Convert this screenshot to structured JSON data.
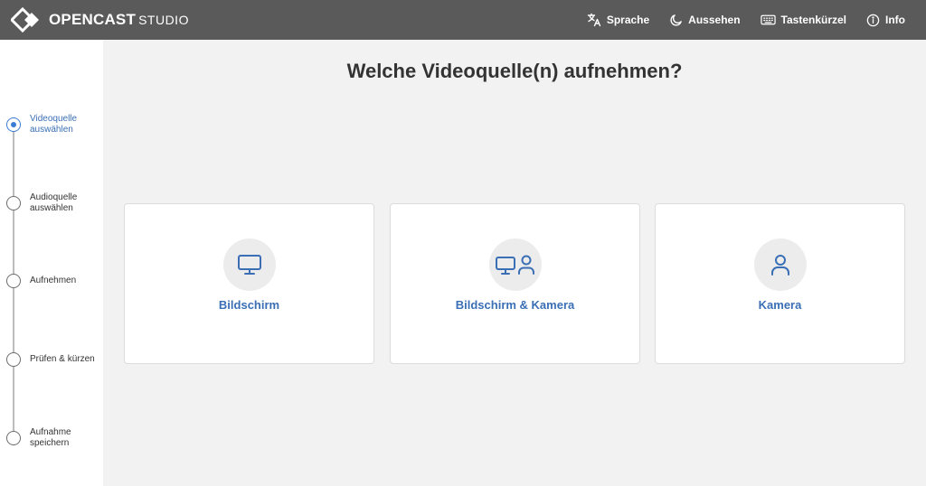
{
  "app": {
    "logo_name": "OPENCAST",
    "logo_suffix": "STUDIO"
  },
  "nav": {
    "language": "Sprache",
    "appearance": "Aussehen",
    "shortcuts": "Tastenkürzel",
    "info": "Info"
  },
  "steps": [
    {
      "label": "Videoquelle\nauswählen",
      "active": true
    },
    {
      "label": "Audioquelle\nauswählen",
      "active": false
    },
    {
      "label": "Aufnehmen",
      "active": false
    },
    {
      "label": "Prüfen & kürzen",
      "active": false
    },
    {
      "label": "Aufnahme\nspeichern",
      "active": false
    }
  ],
  "main": {
    "title": "Welche Videoquelle(n) aufnehmen?",
    "options": [
      {
        "label": "Bildschirm",
        "icon": "monitor-icon"
      },
      {
        "label": "Bildschirm & Kamera",
        "icon": "monitor-user-icon"
      },
      {
        "label": "Kamera",
        "icon": "user-icon"
      }
    ]
  },
  "colors": {
    "header_bg": "#5a5a5a",
    "accent": "#3a6fb5",
    "page_bg": "#f2f2f2"
  }
}
